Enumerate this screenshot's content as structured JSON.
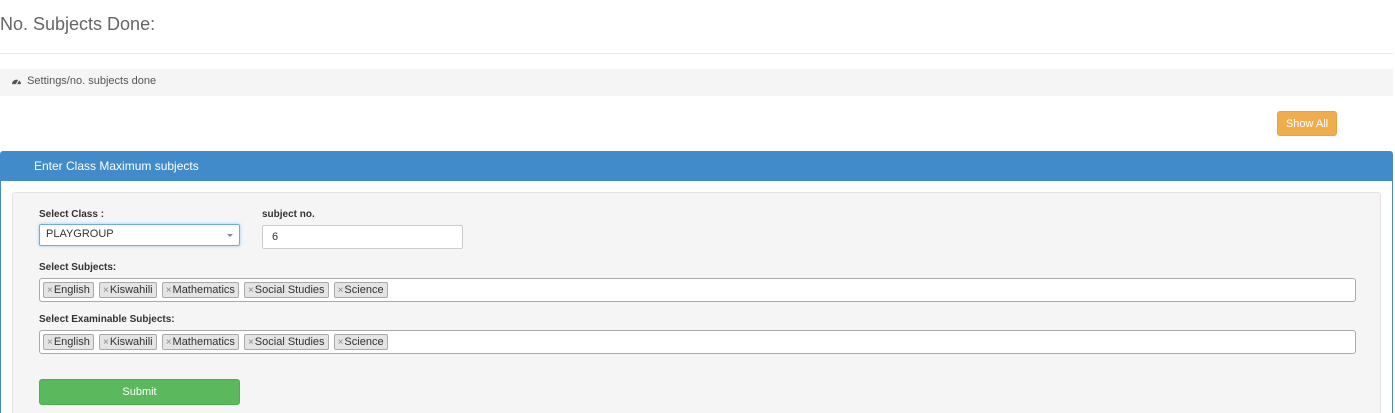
{
  "page": {
    "title": "No. Subjects Done:",
    "breadcrumb_icon": "dashboard-icon",
    "breadcrumb": "Settings/no. subjects done"
  },
  "toolbar": {
    "show_all_label": "Show All"
  },
  "colors": {
    "panel_heading": "#428bca",
    "show_all": "#f0ad4e",
    "submit": "#5cb85c"
  },
  "panel": {
    "heading": "Enter Class Maximum subjects",
    "class_label": "Select Class :",
    "class_value": "PLAYGROUP",
    "subject_no_label": "subject no.",
    "subject_no_value": "6",
    "subjects_label": "Select Subjects:",
    "subjects": [
      "English",
      "Kiswahili",
      "Mathematics",
      "Social Studies",
      "Science"
    ],
    "examinable_label": "Select Examinable Subjects:",
    "examinable": [
      "English",
      "Kiswahili",
      "Mathematics",
      "Social Studies",
      "Science"
    ],
    "remove_glyph": "×",
    "submit_label": "Submit"
  }
}
